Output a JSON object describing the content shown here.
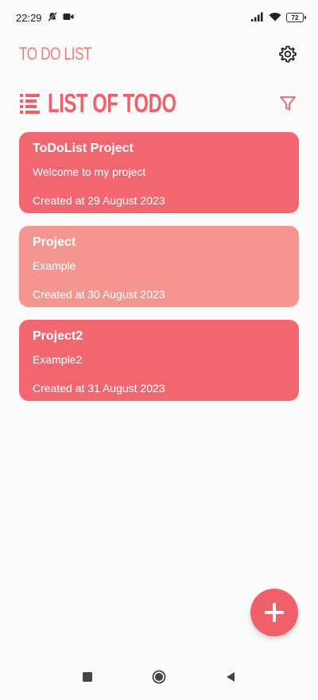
{
  "status_bar": {
    "time": "22:29",
    "battery": "72"
  },
  "header": {
    "title": "TO DO LIST",
    "settings_icon": "gear-icon"
  },
  "section": {
    "title": "LIST OF TODO",
    "list_icon": "list-icon",
    "filter_icon": "filter-icon"
  },
  "todos": [
    {
      "title": "ToDoList Project",
      "description": "Welcome to my project",
      "created": "Created at 29 August 2023",
      "color": "#f26670"
    },
    {
      "title": "Project",
      "description": "Example",
      "created": "Created at 30 August 2023",
      "color": "#f5958f"
    },
    {
      "title": "Project2",
      "description": "Example2",
      "created": "Created at 31 August 2023",
      "color": "#f26670"
    }
  ],
  "fab": {
    "icon": "plus-icon",
    "color": "#f0606a"
  },
  "colors": {
    "accent": "#f0606a",
    "title_light": "#f27b7b",
    "background": "#fafafa"
  },
  "nav": {
    "recent_icon": "square-icon",
    "home_icon": "circle-icon",
    "back_icon": "triangle-back-icon"
  }
}
